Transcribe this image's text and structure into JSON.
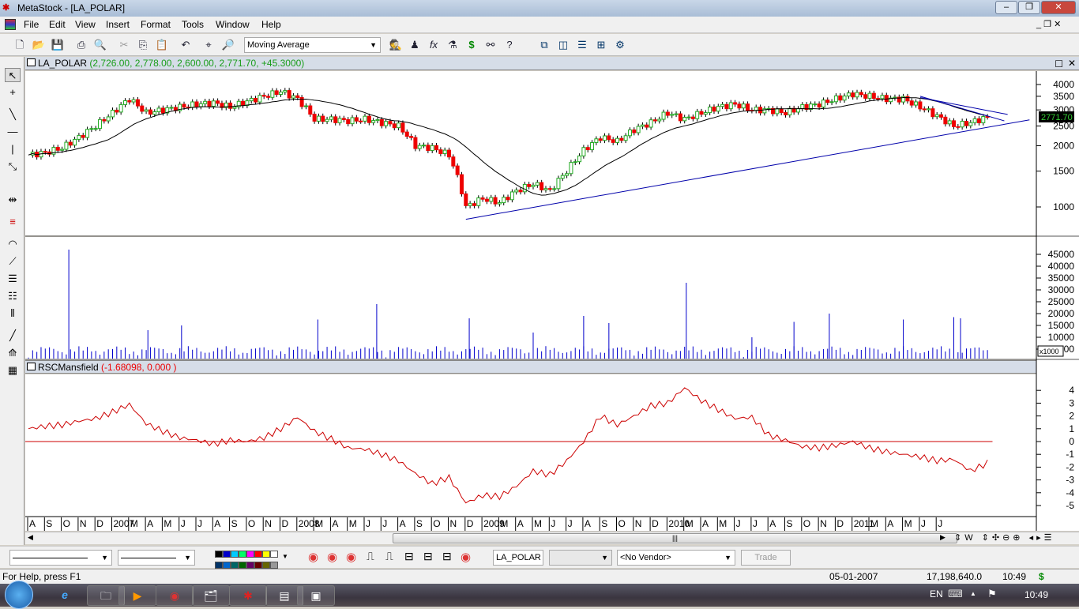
{
  "window": {
    "title": "MetaStock - [LA_POLAR]",
    "min": "–",
    "max": "❐",
    "close": "✕"
  },
  "menu": [
    "File",
    "Edit",
    "View",
    "Insert",
    "Format",
    "Tools",
    "Window",
    "Help"
  ],
  "toolbar": {
    "indicator_select": "Moving Average"
  },
  "price_panel": {
    "symbol": "LA_POLAR",
    "values": "(2,726.00, 2,778.00, 2,600.00, 2,771.70, +45.3000)",
    "last": "2771.70"
  },
  "rsc_panel": {
    "name": "RSCMansfield",
    "values": "(-1.68098, 0.000 )"
  },
  "volume_unit": "x1000",
  "colors": {
    "up": "#22aa22",
    "down": "#ee0000",
    "ma": "#000000",
    "trend": "#0000aa",
    "volume": "#0000cc",
    "rsc": "#cc0000"
  },
  "chart_data": [
    {
      "type": "candlestick",
      "title": "LA_POLAR",
      "scale": "log",
      "yticks": [
        1000,
        1500,
        2000,
        2500,
        3000,
        3500,
        4000
      ],
      "start_month": "2006-08",
      "monthly_close": [
        1800,
        1850,
        1950,
        2200,
        2500,
        2900,
        3400,
        2900,
        3000,
        3100,
        3200,
        3250,
        3100,
        3300,
        3500,
        3700,
        3400,
        2700,
        2700,
        2650,
        2700,
        2600,
        2500,
        2000,
        1950,
        1800,
        1000,
        1100,
        1050,
        1200,
        1300,
        1200,
        1500,
        1900,
        2200,
        2100,
        2400,
        2600,
        2900,
        2700,
        2900,
        3100,
        3200,
        3000,
        3000,
        2900,
        3100,
        3200,
        3400,
        3600,
        3500,
        3400,
        3400,
        3100,
        2800,
        2500,
        2600,
        2771.7
      ],
      "trendlines": [
        {
          "from": [
            26,
            870
          ],
          "to": [
            59.5,
            2680
          ]
        },
        {
          "from": [
            53,
            3500
          ],
          "to": [
            58,
            2650
          ]
        },
        {
          "from": [
            53,
            3450
          ],
          "to": [
            58.2,
            2850
          ]
        }
      ]
    },
    {
      "type": "bar",
      "title": "Volume",
      "unit": "x1000",
      "yticks": [
        5000,
        10000,
        15000,
        20000,
        25000,
        30000,
        35000,
        40000,
        45000
      ],
      "spikes": [
        [
          2.4,
          47000
        ],
        [
          7.1,
          13000
        ],
        [
          9.1,
          15000
        ],
        [
          17.2,
          17500
        ],
        [
          20.7,
          24000
        ],
        [
          26.2,
          18000
        ],
        [
          30,
          12000
        ],
        [
          33,
          19000
        ],
        [
          34.5,
          16000
        ],
        [
          39.1,
          33000
        ],
        [
          43,
          10000
        ],
        [
          45.5,
          16500
        ],
        [
          47.6,
          20000
        ],
        [
          52,
          17500
        ],
        [
          55,
          18500
        ],
        [
          55.4,
          18000
        ]
      ],
      "baseline": 3500
    },
    {
      "type": "line",
      "title": "RSCMansfield",
      "yticks": [
        4,
        3,
        2,
        1,
        0,
        -1,
        -2,
        -3,
        -4,
        -5
      ],
      "reference": 0,
      "monthly": [
        1.0,
        1.2,
        1.3,
        1.6,
        1.8,
        2.3,
        2.9,
        1.4,
        0.8,
        0.3,
        0.1,
        -0.2,
        0.1,
        0.0,
        0.3,
        1.0,
        1.9,
        0.8,
        0.2,
        -0.5,
        -0.6,
        -1.0,
        -1.5,
        -2.5,
        -3.3,
        -2.8,
        -4.8,
        -4.2,
        -4.3,
        -3.5,
        -2.3,
        -2.6,
        -1.5,
        0.0,
        2.0,
        1.3,
        2.0,
        2.8,
        3.0,
        4.2,
        3.2,
        2.5,
        1.8,
        1.9,
        0.5,
        0.1,
        -0.4,
        -0.5,
        -0.3,
        0.0,
        -0.5,
        -0.8,
        -1.0,
        -1.2,
        -1.5,
        -1.4,
        -2.3,
        -1.68
      ]
    },
    {
      "type": "axis",
      "labels": [
        "A",
        "S",
        "O",
        "N",
        "D",
        "2007",
        "M",
        "A",
        "M",
        "J",
        "J",
        "A",
        "S",
        "O",
        "N",
        "D",
        "2008",
        "M",
        "A",
        "M",
        "J",
        "J",
        "A",
        "S",
        "O",
        "N",
        "D",
        "2009",
        "M",
        "A",
        "M",
        "J",
        "J",
        "A",
        "S",
        "O",
        "N",
        "D",
        "2010",
        "M",
        "A",
        "M",
        "J",
        "J",
        "A",
        "S",
        "O",
        "N",
        "D",
        "2011",
        "M",
        "A",
        "M",
        "J",
        "J"
      ]
    }
  ],
  "bottom_toolbar": {
    "symbol": "LA_POLAR",
    "vendor": "<No Vendor>",
    "trade": "Trade"
  },
  "status": {
    "help": "For Help, press F1",
    "date": "05-01-2007",
    "value": "17,198,640.0",
    "time": "10:49",
    "dollar": "$"
  },
  "taskbar": {
    "lang": "EN",
    "clock": "10:49"
  }
}
